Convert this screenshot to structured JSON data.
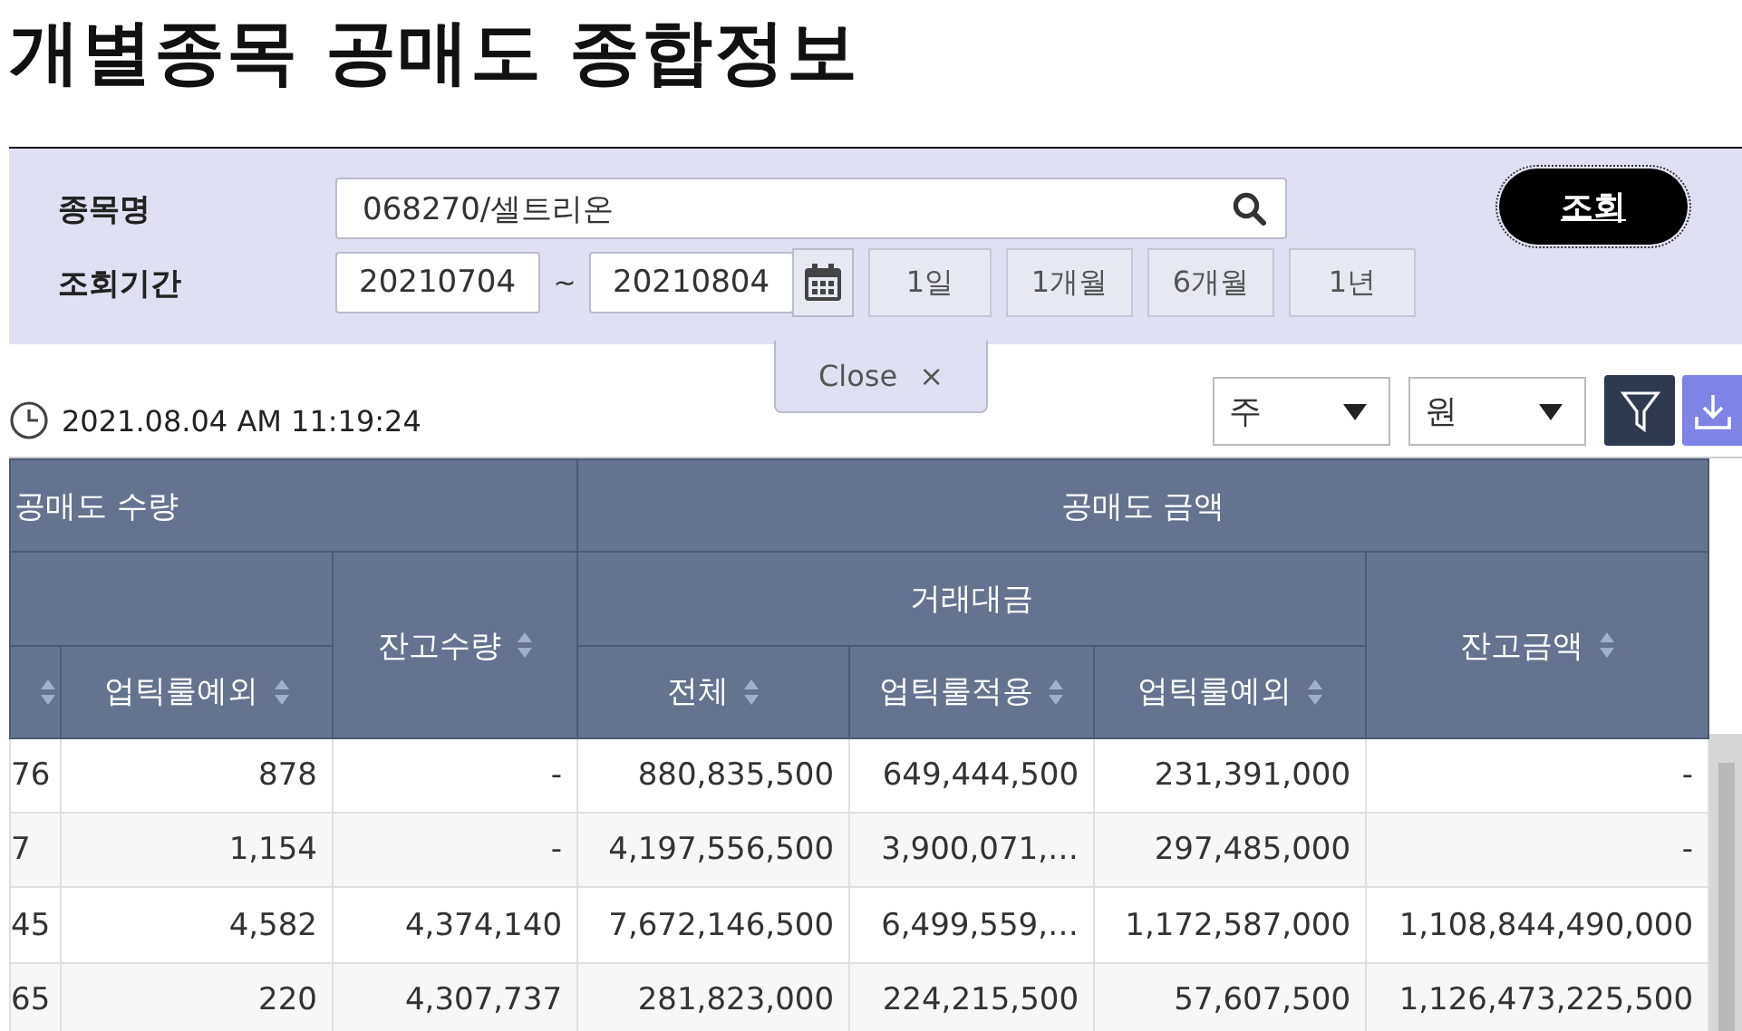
{
  "page": {
    "title": "개별종목 공매도 종합정보"
  },
  "search": {
    "stock_label": "종목명",
    "stock_value": "068270/셀트리온",
    "period_label": "조회기간",
    "date_from": "20210704",
    "separator": "~",
    "date_to": "20210804",
    "period_buttons": [
      "1일",
      "1개월",
      "6개월",
      "1년"
    ],
    "submit": "조회",
    "close": "Close",
    "close_symbol": "×"
  },
  "toolbar": {
    "timestamp": "2021.08.04 AM 11:19:24",
    "unit_select": "주",
    "currency_select": "원"
  },
  "table": {
    "group_headers": [
      "공매도 수량",
      "공매도 금액"
    ],
    "span_header": "거래대금",
    "columns": [
      "",
      "업틱룰예외",
      "잔고수량",
      "전체",
      "업틱룰적용",
      "업틱룰예외",
      "잔고금액"
    ],
    "rows": [
      [
        "76",
        "878",
        "-",
        "880,835,500",
        "649,444,500",
        "231,391,000",
        "-"
      ],
      [
        "7",
        "1,154",
        "-",
        "4,197,556,500",
        "3,900,071,…",
        "297,485,000",
        "-"
      ],
      [
        "45",
        "4,582",
        "4,374,140",
        "7,672,146,500",
        "6,499,559,…",
        "1,172,587,000",
        "1,108,844,490,000"
      ],
      [
        "65",
        "220",
        "4,307,737",
        "281,823,000",
        "224,215,500",
        "57,607,500",
        "1,126,473,225,500"
      ]
    ]
  }
}
